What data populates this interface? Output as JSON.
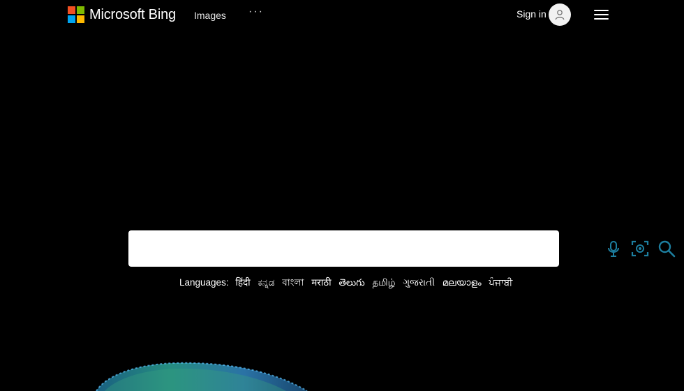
{
  "brand": {
    "name": "Microsoft Bing",
    "colors": {
      "square_red": "#f25022",
      "square_green": "#7fba00",
      "square_blue": "#00a4ef",
      "square_yellow": "#ffb900"
    }
  },
  "header": {
    "nav_images": "Images",
    "nav_more": "···",
    "sign_in": "Sign in",
    "avatar_icon": "person-icon",
    "menu_icon": "hamburger-menu-icon"
  },
  "search": {
    "value": "",
    "placeholder": "",
    "icons": [
      "microphone-icon",
      "visual-search-icon",
      "search-icon"
    ],
    "accent_color": "#1d7fa0"
  },
  "languages": {
    "label": "Languages:",
    "items": [
      "हिंदी",
      "ಕನ್ನಡ",
      "বাংলা",
      "मराठी",
      "తెలుగు",
      "தமிழ்",
      "ગુજરાતી",
      "മലയാളം",
      "ਪੰਜਾਬੀ"
    ]
  },
  "background": {
    "color": "#000000"
  }
}
